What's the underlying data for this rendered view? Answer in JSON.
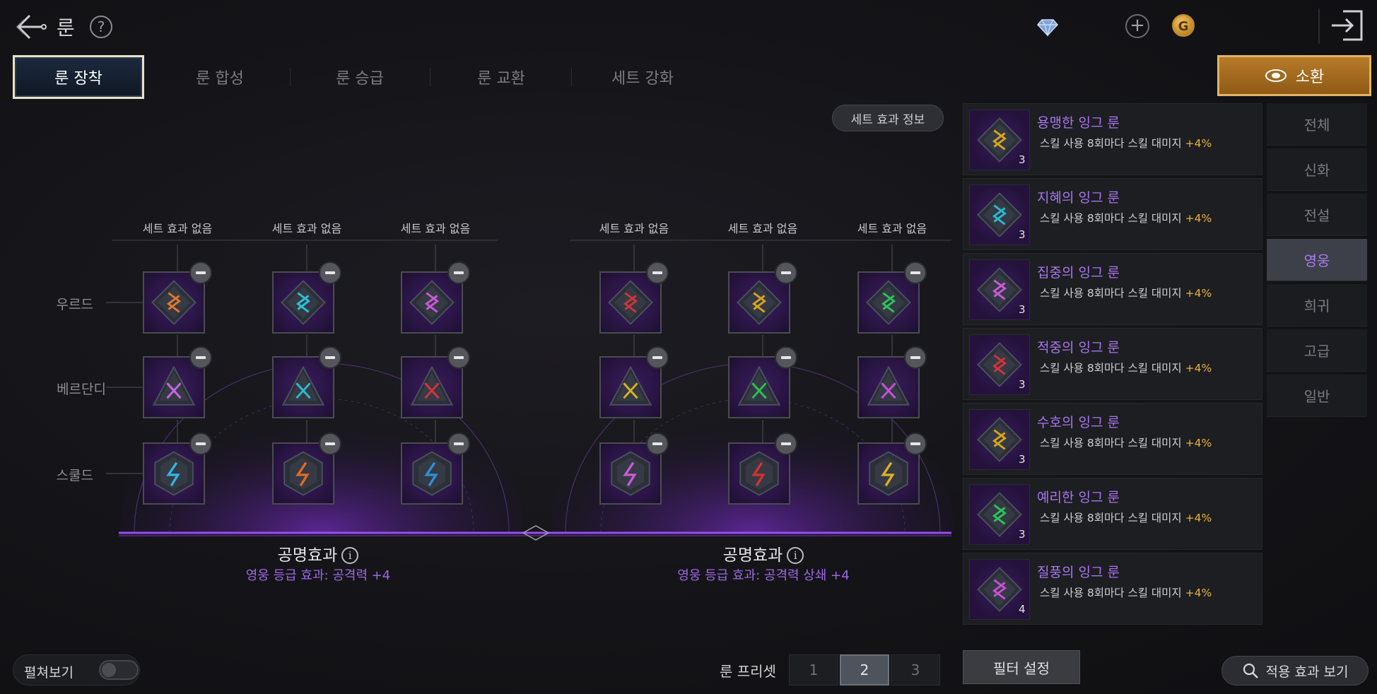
{
  "header": {
    "title": "룬",
    "icons": [
      "back-arrow-icon",
      "help-icon",
      "diamond-icon",
      "plus-icon",
      "gold-coin-icon",
      "exit-icon"
    ],
    "gold_symbol": "G",
    "help_symbol": "?",
    "plus_symbol": "+"
  },
  "tabs": [
    {
      "label": "룬 장착",
      "active": true
    },
    {
      "label": "룬 합성",
      "active": false
    },
    {
      "label": "룬 승급",
      "active": false
    },
    {
      "label": "룬 교환",
      "active": false
    },
    {
      "label": "세트 강화",
      "active": false
    }
  ],
  "summon": {
    "label": "소환"
  },
  "set_info_button": "세트 효과 정보",
  "board": {
    "row_labels": [
      "우르드",
      "베르단디",
      "스쿨드"
    ],
    "set_labels": [
      "세트 효과 없음",
      "세트 효과 없음",
      "세트 효과 없음",
      "세트 효과 없음",
      "세트 효과 없음",
      "세트 효과 없음"
    ],
    "slot_colors": [
      [
        "#e0782c",
        "#2bc2d6",
        "#cc58d8",
        "#d2333a",
        "#d8a41c",
        "#2cc45a"
      ],
      [
        "#c268e0",
        "#2bb8d0",
        "#d83040",
        "#d8b020",
        "#2cc050",
        "#c850d6"
      ],
      [
        "#2fb4e0",
        "#e06a22",
        "#2c90d8",
        "#cc58d8",
        "#d83030",
        "#dcb020"
      ]
    ],
    "slot_shapes": [
      "diamond",
      "triangle",
      "hex"
    ],
    "left_resonance": {
      "title": "공명효과",
      "info_symbol": "i",
      "effect": "영웅 등급 효과: 공격력 +4"
    },
    "right_resonance": {
      "title": "공명효과",
      "info_symbol": "i",
      "effect": "영웅 등급 효과: 공격력 상쇄 +4"
    }
  },
  "rune_list": [
    {
      "name": "용맹한 잉그 룬",
      "desc": "스킬 사용 8회마다 스킬 대미지",
      "bonus": "+4%",
      "count": "3",
      "color": "#d8a41c"
    },
    {
      "name": "지혜의 잉그 룬",
      "desc": "스킬 사용 8회마다 스킬 대미지",
      "bonus": "+4%",
      "count": "3",
      "color": "#2bb8d0"
    },
    {
      "name": "집중의 잉그 룬",
      "desc": "스킬 사용 8회마다 스킬 대미지",
      "bonus": "+4%",
      "count": "3",
      "color": "#cc58d8"
    },
    {
      "name": "적중의 잉그 룬",
      "desc": "스킬 사용 8회마다 스킬 대미지",
      "bonus": "+4%",
      "count": "3",
      "color": "#d2333a"
    },
    {
      "name": "수호의 잉그 룬",
      "desc": "스킬 사용 8회마다 스킬 대미지",
      "bonus": "+4%",
      "count": "3",
      "color": "#d8a41c"
    },
    {
      "name": "예리한 잉그 룬",
      "desc": "스킬 사용 8회마다 스킬 대미지",
      "bonus": "+4%",
      "count": "3",
      "color": "#2cc45a"
    },
    {
      "name": "질풍의 잉그 룬",
      "desc": "스킬 사용 8회마다 스킬 대미지",
      "bonus": "+4%",
      "count": "4",
      "color": "#c850d6"
    }
  ],
  "grades": [
    {
      "label": "전체",
      "active": false
    },
    {
      "label": "신화",
      "active": false
    },
    {
      "label": "전설",
      "active": false
    },
    {
      "label": "영웅",
      "active": true
    },
    {
      "label": "희귀",
      "active": false
    },
    {
      "label": "고급",
      "active": false
    },
    {
      "label": "일반",
      "active": false
    }
  ],
  "footer": {
    "toggle_label": "펼쳐보기",
    "toggle_on": false,
    "preset_label": "룬 프리셋",
    "presets": [
      {
        "label": "1",
        "active": false
      },
      {
        "label": "2",
        "active": true
      },
      {
        "label": "3",
        "active": false
      }
    ],
    "filter_button": "필터 설정",
    "apply_button": "적용 효과 보기"
  }
}
